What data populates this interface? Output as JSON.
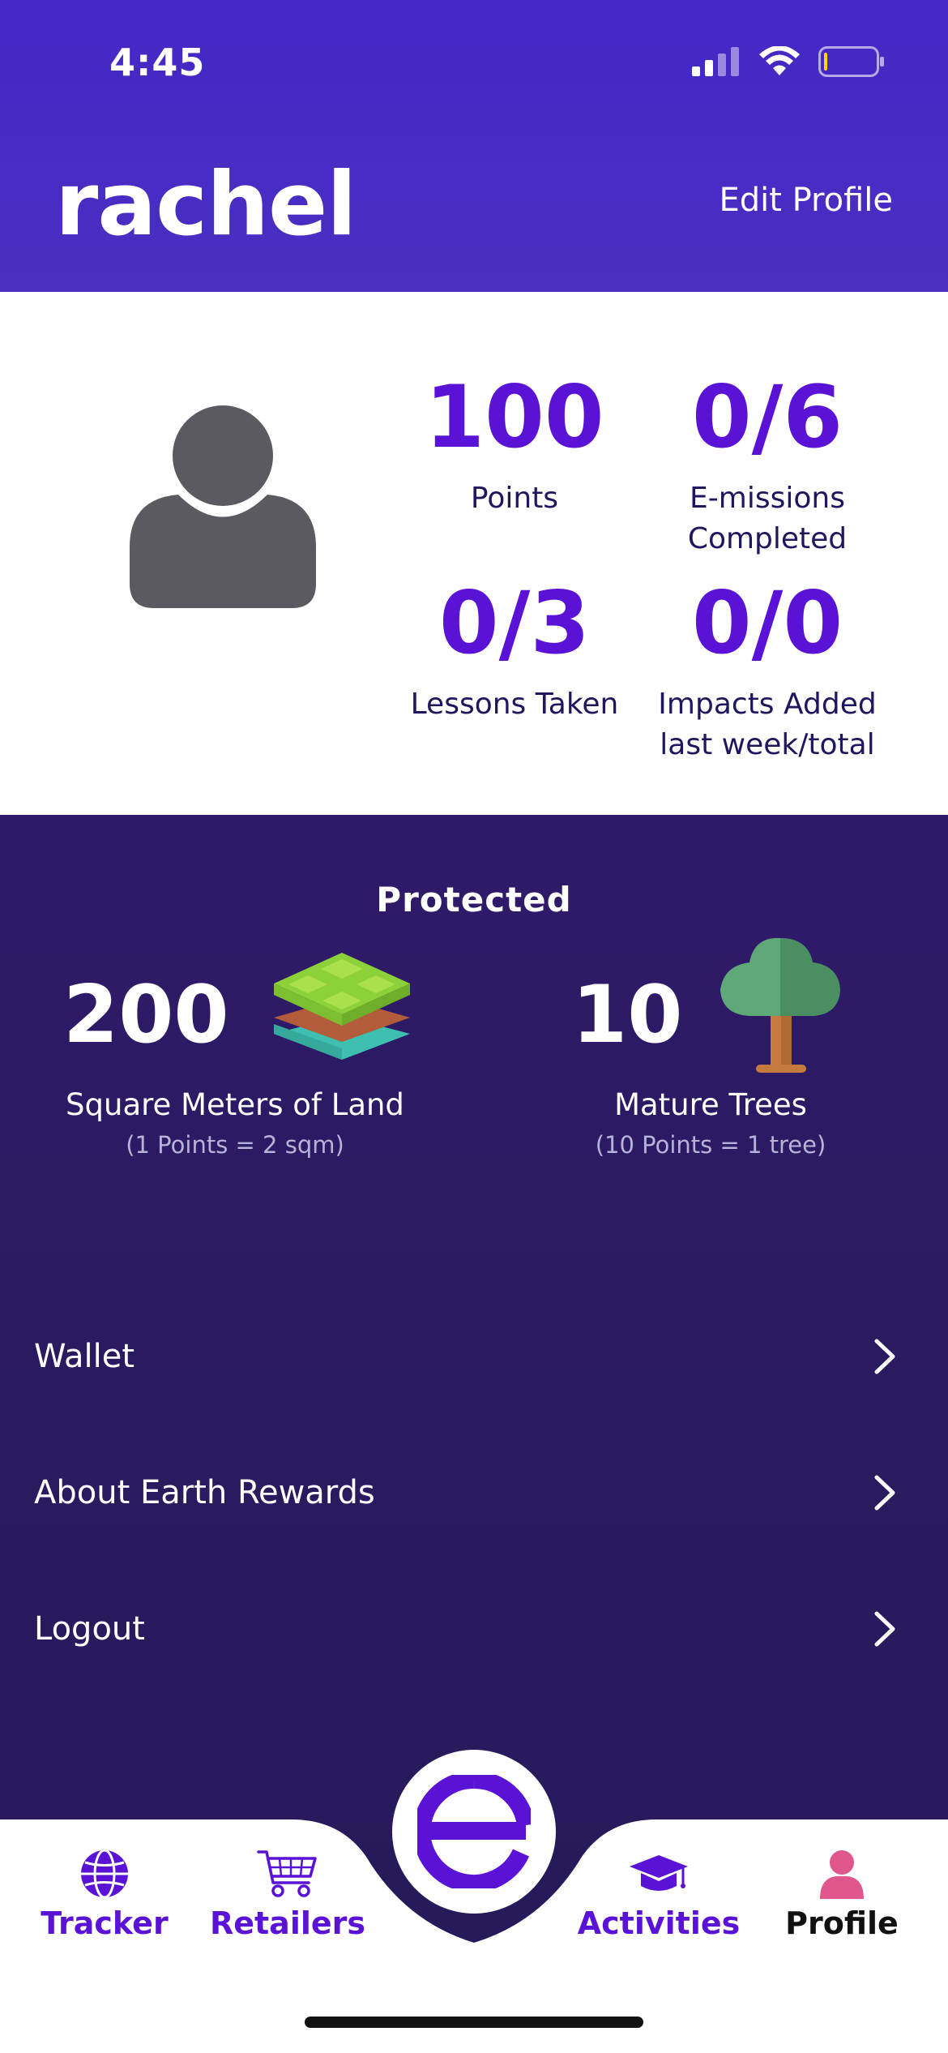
{
  "status_bar": {
    "time": "4:45"
  },
  "header": {
    "username": "rachel",
    "edit_label": "Edit Profile",
    "bg_color": "#4527c6"
  },
  "stats": [
    {
      "value": "100",
      "label": "Points"
    },
    {
      "value": "0/6",
      "label": "E-missions Completed"
    },
    {
      "value": "0/3",
      "label": "Lessons Taken"
    },
    {
      "value": "0/0",
      "label": "Impacts Added last week/total"
    }
  ],
  "protected": {
    "title": "Protected",
    "land": {
      "value": "200",
      "label": "Square Meters of Land",
      "sub": "(1 Points = 2 sqm)",
      "icon": "land-layers-icon"
    },
    "trees": {
      "value": "10",
      "label": "Mature Trees",
      "sub": "(10 Points = 1 tree)",
      "icon": "tree-icon"
    }
  },
  "menu": [
    {
      "label": "Wallet"
    },
    {
      "label": "About Earth Rewards"
    },
    {
      "label": "Logout"
    }
  ],
  "nav": {
    "items": [
      {
        "label": "Tracker",
        "icon": "globe-icon"
      },
      {
        "label": "Retailers",
        "icon": "cart-icon"
      },
      {
        "label": "Activities",
        "icon": "graduation-cap-icon"
      },
      {
        "label": "Profile",
        "icon": "person-icon",
        "active": true
      }
    ],
    "center_icon": "earth-logo-icon",
    "accent_color": "#5a12d6"
  }
}
